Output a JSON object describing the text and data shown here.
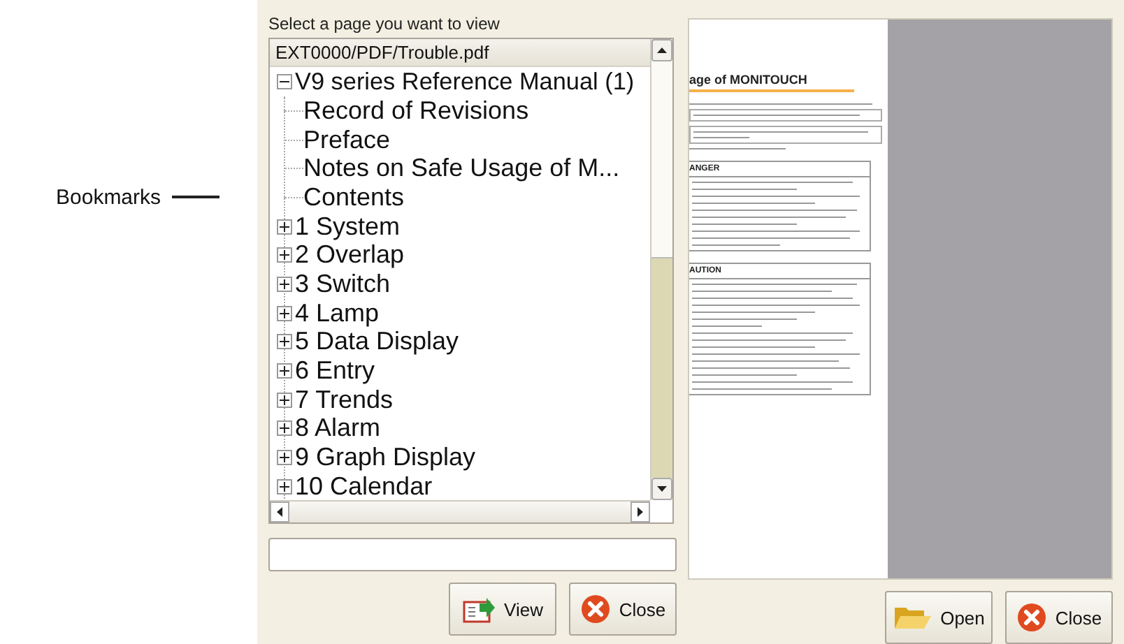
{
  "callout": {
    "label": "Bookmarks"
  },
  "dialog": {
    "instruction": "Select a page you want to view",
    "tree": {
      "path": "EXT0000/PDF/Trouble.pdf",
      "root": {
        "label": "V9 series Reference Manual (1)",
        "expanded": true,
        "children": [
          {
            "label": "Record of Revisions",
            "kind": "leaf"
          },
          {
            "label": "Preface",
            "kind": "leaf"
          },
          {
            "label": "Notes on Safe Usage of M...",
            "kind": "leaf"
          },
          {
            "label": "Contents",
            "kind": "leaf"
          },
          {
            "label": "1 System",
            "kind": "folder",
            "expanded": false
          },
          {
            "label": "2 Overlap",
            "kind": "folder",
            "expanded": false
          },
          {
            "label": "3 Switch",
            "kind": "folder",
            "expanded": false
          },
          {
            "label": "4 Lamp",
            "kind": "folder",
            "expanded": false
          },
          {
            "label": "5 Data Display",
            "kind": "folder",
            "expanded": false
          },
          {
            "label": "6 Entry",
            "kind": "folder",
            "expanded": false
          },
          {
            "label": "7 Trends",
            "kind": "folder",
            "expanded": false
          },
          {
            "label": "8 Alarm",
            "kind": "folder",
            "expanded": false
          },
          {
            "label": "9 Graph Display",
            "kind": "folder",
            "expanded": false
          },
          {
            "label": "10 Calendar",
            "kind": "folder",
            "expanded": false
          }
        ]
      }
    },
    "buttons": [
      {
        "label": "View",
        "kind": "view"
      },
      {
        "label": "Close",
        "kind": "close"
      }
    ]
  },
  "preview": {
    "title": "age of MONITOUCH",
    "sections": [
      {
        "heading": "ANGER"
      },
      {
        "heading": "AUTION"
      }
    ],
    "buttons": [
      {
        "label": "Open",
        "kind": "open"
      },
      {
        "label": "Close",
        "kind": "close"
      }
    ]
  }
}
